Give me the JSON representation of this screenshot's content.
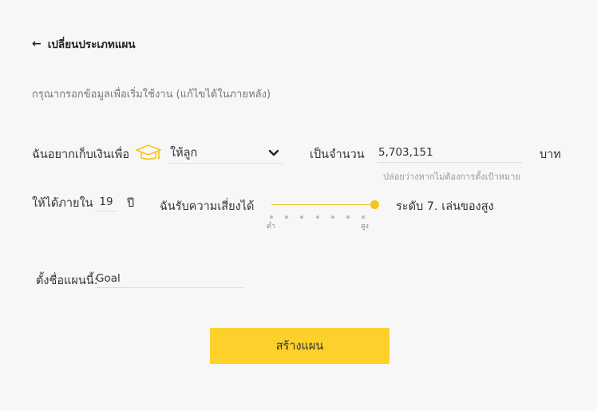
{
  "header": {
    "back_label": "เปลี่ยนประเภทแผน"
  },
  "intro_text": "กรุณากรอกข้อมูลเพื่อเริ่มใช้งาน (แก้ไขได้ในภายหลัง)",
  "goal": {
    "prefix": "ฉันอยากเก็บเงินเพื่อ",
    "icon": "graduation-cap-icon",
    "selected": "ให้ลูก",
    "amount_prefix": "เป็นจำนวน",
    "amount_value": "5,703,151",
    "amount_unit": "บาท",
    "amount_hint": "ปล่อยว่างหากไม่ต้องการตั้งเป้าหมาย"
  },
  "timeline": {
    "prefix": "ให้ได้ภายใน",
    "years_value": "19",
    "years_unit": "ปี"
  },
  "risk": {
    "prefix": "ฉันรับความเสี่ยงได้",
    "min_label": "ต่ำ",
    "max_label": "สูง",
    "levels": 7,
    "selected_level": 7,
    "level_text": "ระดับ 7. เล่นของสูง"
  },
  "plan_name": {
    "label": "ตั้งชื่อแผนนี้:",
    "value": "Goal"
  },
  "actions": {
    "create_label": "สร้างแผน"
  },
  "colors": {
    "accent": "#fdd02b",
    "icon_yellow": "#f5c518",
    "background": "#f7f7f7"
  }
}
